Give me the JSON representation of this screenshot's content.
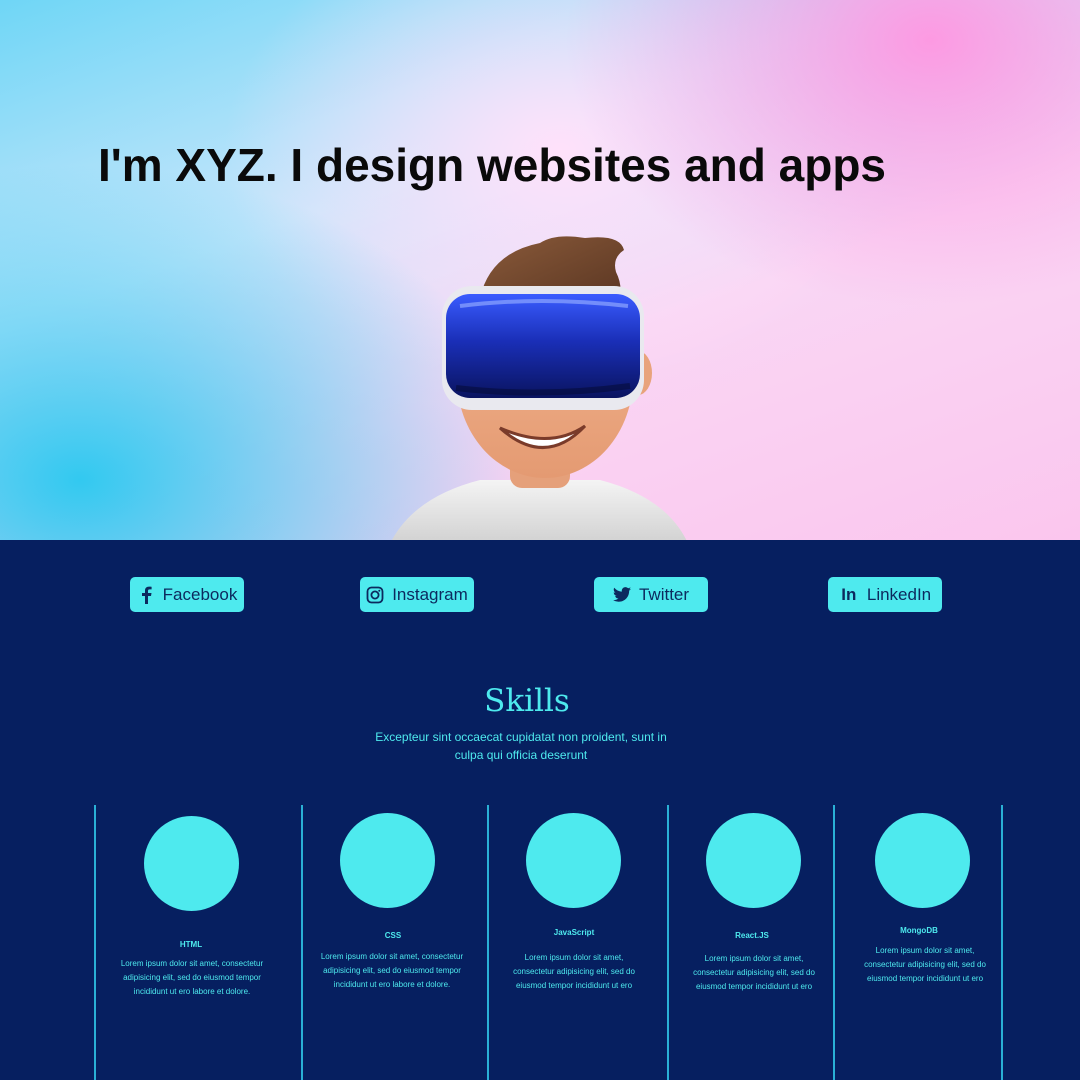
{
  "hero": {
    "title": "I'm XYZ. I design websites and apps",
    "illustration": "vr-headset-character"
  },
  "social": [
    {
      "label": "Facebook",
      "icon": "facebook-icon"
    },
    {
      "label": "Instagram",
      "icon": "instagram-icon"
    },
    {
      "label": "Twitter",
      "icon": "twitter-icon"
    },
    {
      "label": "LinkedIn",
      "icon": "linkedin-icon"
    }
  ],
  "skills": {
    "title": "Skills",
    "subtitle": "Excepteur sint occaecat cupidatat non proident, sunt in culpa qui officia deserunt",
    "items": [
      {
        "name": "HTML",
        "text": "Lorem ipsum dolor sit amet, consectetur adipisicing elit, sed do eiusmod tempor incididunt ut ero labore et dolore."
      },
      {
        "name": "CSS",
        "text": "Lorem ipsum dolor sit amet, consectetur adipisicing elit, sed do eiusmod tempor incididunt ut ero labore et dolore."
      },
      {
        "name": "JavaScript",
        "text": "Lorem ipsum dolor sit amet, consectetur adipisicing elit, sed do eiusmod tempor incididunt ut ero"
      },
      {
        "name": "React.JS",
        "text": "Lorem ipsum dolor sit amet, consectetur adipisicing elit, sed do eiusmod tempor incididunt ut ero"
      },
      {
        "name": "MongoDB",
        "text": "Lorem ipsum dolor sit amet, consectetur adipisicing elit, sed do eiusmod tempor incididunt ut ero"
      }
    ]
  },
  "colors": {
    "background": "#061f60",
    "accent": "#4eeaee",
    "button_text": "#0c2a5e",
    "title": "#0a0a0a"
  }
}
